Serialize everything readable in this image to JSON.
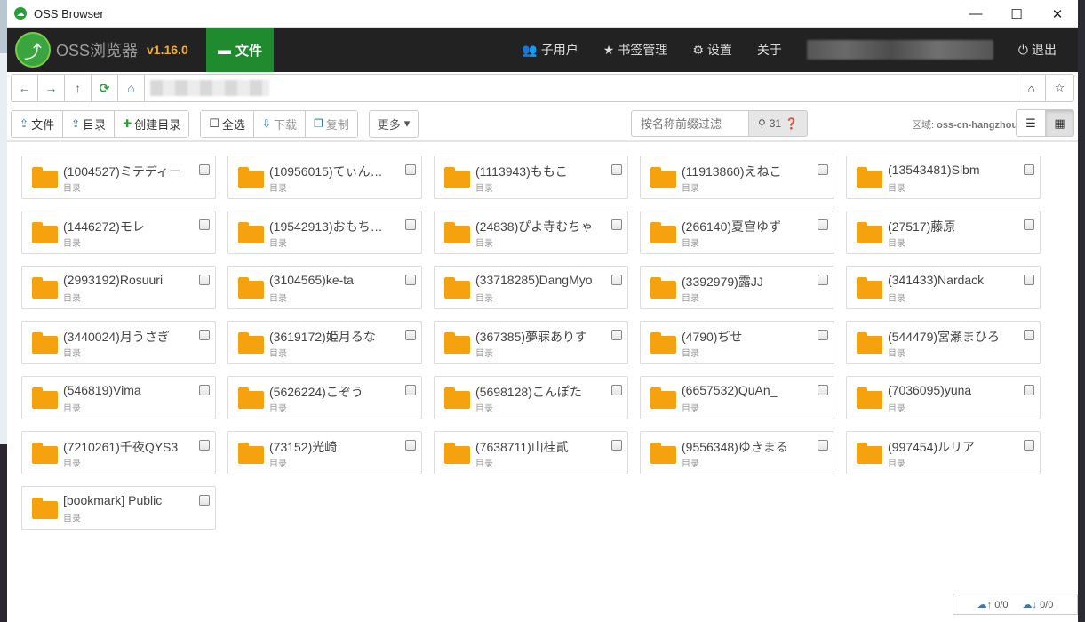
{
  "window": {
    "title": "OSS Browser"
  },
  "navbar": {
    "brand_name": "OSS浏览器",
    "version": "v1.16.0",
    "active_tab": "文件",
    "items": [
      {
        "label": "子用户",
        "icon": "users-icon"
      },
      {
        "label": "书签管理",
        "icon": "star-icon"
      },
      {
        "label": "设置",
        "icon": "gear-icon"
      },
      {
        "label": "关于",
        "icon": ""
      }
    ],
    "logout": "退出"
  },
  "toolbar": {
    "upload_file": "文件",
    "upload_dir": "目录",
    "create_dir": "创建目录",
    "select_all": "全选",
    "download": "下载",
    "copy": "复制",
    "more": "更多",
    "search_placeholder": "按名称前缀过滤",
    "search_count": "31",
    "region_label": "区域:",
    "region_value": "oss-cn-hangzhou"
  },
  "folders": [
    {
      "name": "(1004527)ミテディー",
      "type": "目录"
    },
    {
      "name": "(10956015)てぃん…",
      "type": "目录"
    },
    {
      "name": "(1113943)ももこ",
      "type": "目录"
    },
    {
      "name": "(11913860)えねこ",
      "type": "目录"
    },
    {
      "name": "(13543481)Slbm",
      "type": "目录"
    },
    {
      "name": "(1446272)モレ",
      "type": "目录"
    },
    {
      "name": "(19542913)おもち…",
      "type": "目录"
    },
    {
      "name": "(24838)ぴよ寺むちゃ",
      "type": "目录"
    },
    {
      "name": "(266140)夏宫ゆず",
      "type": "目录"
    },
    {
      "name": "(27517)藤原",
      "type": "目录"
    },
    {
      "name": "(2993192)Rosuuri",
      "type": "目录"
    },
    {
      "name": "(3104565)ke-ta",
      "type": "目录"
    },
    {
      "name": "(33718285)DangMyo",
      "type": "目录"
    },
    {
      "name": "(3392979)露JJ",
      "type": "目录"
    },
    {
      "name": "(341433)Nardack",
      "type": "目录"
    },
    {
      "name": "(3440024)月うさぎ",
      "type": "目录"
    },
    {
      "name": "(3619172)姫月るな",
      "type": "目录"
    },
    {
      "name": "(367385)夢寐ありす",
      "type": "目录"
    },
    {
      "name": "(4790)ぢせ",
      "type": "目录"
    },
    {
      "name": "(544479)宮瀬まひろ",
      "type": "目录"
    },
    {
      "name": "(546819)Vima",
      "type": "目录"
    },
    {
      "name": "(5626224)こぞう",
      "type": "目录"
    },
    {
      "name": "(5698128)こんぽた",
      "type": "目录"
    },
    {
      "name": "(6657532)QuAn_",
      "type": "目录"
    },
    {
      "name": "(7036095)yuna",
      "type": "目录"
    },
    {
      "name": "(7210261)千夜QYS3",
      "type": "目录"
    },
    {
      "name": "(73152)光崎",
      "type": "目录"
    },
    {
      "name": "(7638711)山桂貳",
      "type": "目录"
    },
    {
      "name": "(9556348)ゆきまる",
      "type": "目录"
    },
    {
      "name": "(997454)ルリア",
      "type": "目录"
    },
    {
      "name": "[bookmark] Public",
      "type": "目录"
    }
  ],
  "status": {
    "upload": "0/0",
    "download": "0/0"
  },
  "colors": {
    "navbar": "#222222",
    "active_tab": "#1f8a2e",
    "version": "#f0ad2e",
    "folder": "#f5a20e",
    "link": "#337ab7"
  }
}
